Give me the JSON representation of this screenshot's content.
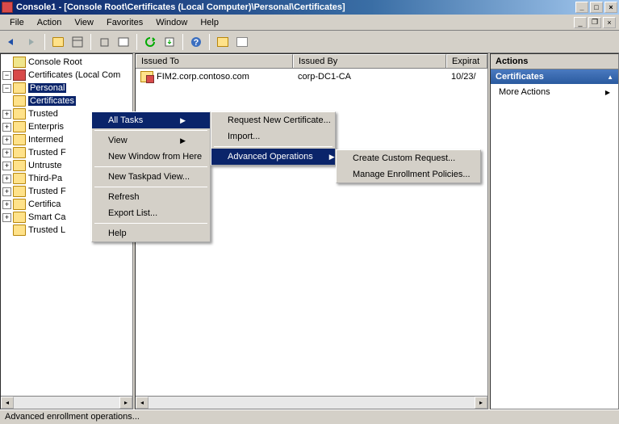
{
  "window": {
    "title": "Console1 - [Console Root\\Certificates (Local Computer)\\Personal\\Certificates]"
  },
  "menu": {
    "file": "File",
    "action": "Action",
    "view": "View",
    "favorites": "Favorites",
    "window": "Window",
    "help": "Help"
  },
  "tree": {
    "root": "Console Root",
    "certsLocal": "Certificates (Local Com",
    "personal": "Personal",
    "certificates": "Certificates",
    "items": [
      "Trusted",
      "Enterpris",
      "Intermed",
      "Trusted F",
      "Untruste",
      "Third-Pa",
      "Trusted F",
      "Certifica",
      "Smart Ca",
      "Trusted L"
    ]
  },
  "list": {
    "columns": {
      "issuedTo": "Issued To",
      "issuedBy": "Issued By",
      "expiration": "Expirat"
    },
    "rows": [
      {
        "issuedTo": "FIM2.corp.contoso.com",
        "issuedBy": "corp-DC1-CA",
        "expiration": "10/23/"
      }
    ]
  },
  "actions": {
    "header": "Actions",
    "group": "Certificates",
    "more": "More Actions"
  },
  "context": {
    "menu1": {
      "allTasks": "All Tasks",
      "view": "View",
      "newWindow": "New Window from Here",
      "newTaskpad": "New Taskpad View...",
      "refresh": "Refresh",
      "exportList": "Export List...",
      "help": "Help"
    },
    "menu2": {
      "requestNew": "Request New Certificate...",
      "import": "Import...",
      "advanced": "Advanced Operations"
    },
    "menu3": {
      "createCustom": "Create Custom Request...",
      "managePolicies": "Manage Enrollment Policies..."
    }
  },
  "status": "Advanced enrollment operations..."
}
